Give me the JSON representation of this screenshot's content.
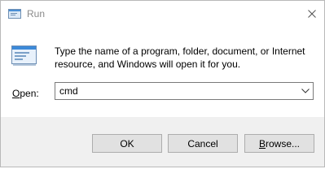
{
  "window": {
    "title": "Run",
    "close_icon": "close-icon",
    "title_icon": "run-icon"
  },
  "body": {
    "description": "Type the name of a program, folder, document, or Internet resource, and Windows will open it for you.",
    "open_label_accel": "O",
    "open_label_rest": "pen:",
    "open_value": "cmd"
  },
  "buttons": {
    "ok": "OK",
    "cancel": "Cancel",
    "browse_accel": "B",
    "browse_rest": "rowse..."
  }
}
